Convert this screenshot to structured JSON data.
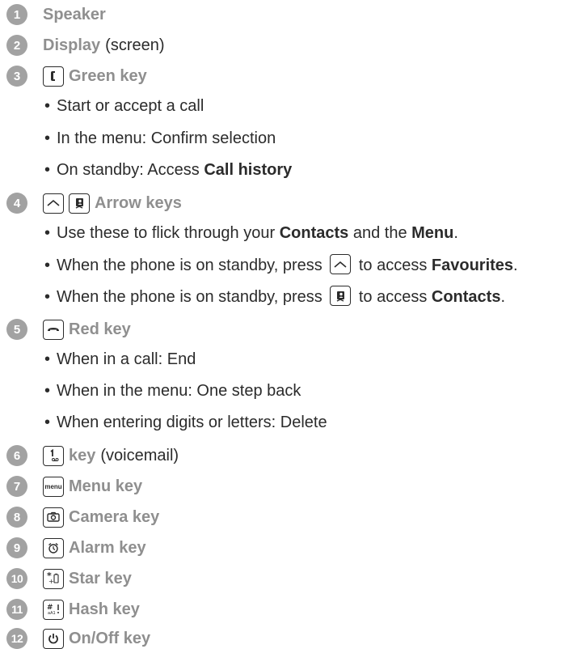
{
  "items": [
    {
      "number": "1",
      "title": "Speaker"
    },
    {
      "number": "2",
      "title": "Display",
      "note": "(screen)"
    },
    {
      "number": "3",
      "title": "Green key",
      "icon": "green-call-key-icon",
      "bullets": [
        {
          "text": "Start or accept a call"
        },
        {
          "text": "In the menu: Confirm selection"
        },
        {
          "text": "On standby: Access ",
          "bold": "Call history"
        }
      ]
    },
    {
      "number": "4",
      "title": "Arrow keys",
      "icon": "arrow-up-key-icon",
      "icon2": "contacts-key-icon",
      "bullets": [
        {
          "pre": "Use these to flick through your ",
          "bold1": "Contacts",
          "mid": " and the ",
          "bold2": "Menu",
          "post": "."
        },
        {
          "pre": "When the phone is on standby, press ",
          "icon": "arrow-up-key-icon",
          "mid": " to access ",
          "bold": "Favourites",
          "post": "."
        },
        {
          "pre": "When the phone is on standby, press ",
          "icon": "contacts-key-icon",
          "mid": " to access ",
          "bold": "Contacts",
          "post": "."
        }
      ]
    },
    {
      "number": "5",
      "title": "Red key",
      "icon": "red-end-key-icon",
      "bullets": [
        {
          "text": "When in a call: End"
        },
        {
          "text": "When in the menu: One step back"
        },
        {
          "text": "When entering digits or letters: Delete"
        }
      ]
    },
    {
      "number": "6",
      "title": "key",
      "note": "(voicemail)",
      "icon": "voicemail-1-key-icon"
    },
    {
      "number": "7",
      "title": "Menu key",
      "icon": "menu-key-icon",
      "icon_text": "menu"
    },
    {
      "number": "8",
      "title": "Camera key",
      "icon": "camera-key-icon"
    },
    {
      "number": "9",
      "title": "Alarm key",
      "icon": "alarm-key-icon"
    },
    {
      "number": "10",
      "title": "Star key",
      "icon": "star-key-icon"
    },
    {
      "number": "11",
      "title": "Hash key",
      "icon": "hash-key-icon"
    },
    {
      "number": "12",
      "title": "On/Off key",
      "icon": "power-key-icon"
    }
  ],
  "colors": {
    "badge": "#a2a2a2",
    "heading": "#8f8f8f",
    "text": "#2b2b2b"
  }
}
